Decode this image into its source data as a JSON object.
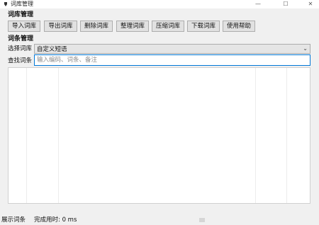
{
  "window": {
    "title": "词库管理",
    "minimize_glyph": "—",
    "maximize_glyph": "☐",
    "close_glyph": "✕"
  },
  "dict_section": {
    "title": "词库管理",
    "buttons": [
      {
        "label": "导入词库"
      },
      {
        "label": "导出词库"
      },
      {
        "label": "删除词库"
      },
      {
        "label": "整理词库"
      },
      {
        "label": "压缩词库"
      },
      {
        "label": "下载词库"
      },
      {
        "label": "使用帮助"
      }
    ]
  },
  "entry_section": {
    "title": "词条管理",
    "select_label": "选择词库",
    "select_value": "自定义短语",
    "search_label": "查找词条",
    "search_placeholder": "输入编码、词条、备注",
    "search_value": ""
  },
  "status": {
    "show_entries": "展示词条",
    "time_label": "完成用时: 0 ms"
  }
}
